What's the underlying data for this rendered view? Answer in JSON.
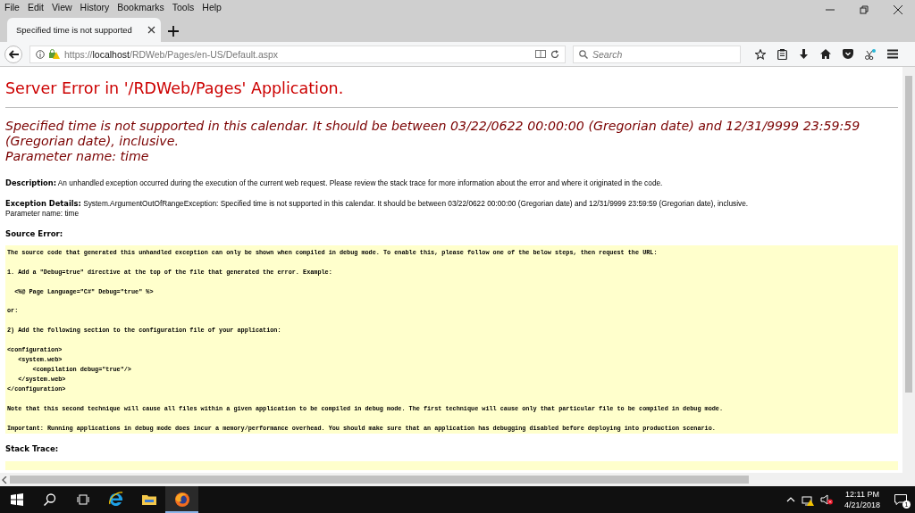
{
  "menu": [
    "File",
    "Edit",
    "View",
    "History",
    "Bookmarks",
    "Tools",
    "Help"
  ],
  "tabs": [
    {
      "title": "Specified time is not supported",
      "selected": true
    }
  ],
  "address": {
    "scheme": "https://",
    "host": "localhost",
    "path": "/RDWeb/Pages/en-US/Default.aspx"
  },
  "search": {
    "placeholder": "Search"
  },
  "page": {
    "title": "Server Error in '/RDWeb/Pages' Application.",
    "error_message": [
      "Specified time is not supported in this calendar. It should be between 03/22/0622 00:00:00 (Gregorian date) and 12/31/9999 23:59:59 (Gregorian date), inclusive.",
      "Parameter name: time"
    ],
    "description_label": "Description:",
    "description": "An unhandled exception occurred during the execution of the current web request. Please review the stack trace for more information about the error and where it originated in the code.",
    "exception_label": "Exception Details:",
    "exception": "System.ArgumentOutOfRangeException: Specified time is not supported in this calendar. It should be between 03/22/0622 00:00:00 (Gregorian date) and 12/31/9999 23:59:59 (Gregorian date), inclusive.",
    "parameter": "Parameter name: time",
    "source_error_label": "Source Error:",
    "source_error": [
      [
        "The source code that generated this unhandled exception can only be shown when compiled in debug mode. To enable this, please follow one of the below steps, then request the URL:"
      ],
      [
        "1. Add a \"Debug=true\" directive at the top of the file that generated the error. Example:"
      ],
      [
        "  <%@ Page Language=\"C#\" Debug=\"true\" %>"
      ],
      [
        "or:"
      ],
      [
        "2) Add the following section to the configuration file of your application:"
      ],
      [
        "<configuration>",
        "   <system.web>",
        "       <compilation debug=\"true\"/>",
        "   </system.web>",
        "</configuration>"
      ],
      [
        "Note that this second technique will cause all files within a given application to be compiled in debug mode. The first technique will cause only that particular file to be compiled in debug mode."
      ],
      [
        "Important: Running applications in debug mode does incur a memory/performance overhead. You should make sure that an application has debugging disabled before deploying into production scenario."
      ]
    ],
    "stack_trace_label": "Stack Trace:"
  },
  "taskbar": {
    "apps": [
      {
        "kind": "ie",
        "running": false
      },
      {
        "kind": "explorer",
        "running": false
      },
      {
        "kind": "firefox",
        "running": true
      }
    ],
    "time": "12:11 PM",
    "date": "4/21/2018",
    "notifications": "1"
  }
}
